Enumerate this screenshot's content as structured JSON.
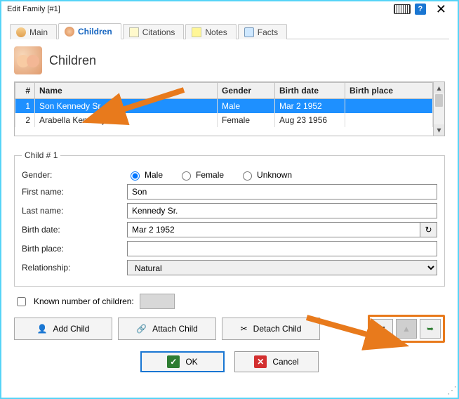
{
  "window": {
    "title": "Edit Family [#1]"
  },
  "tabs": {
    "main": "Main",
    "children": "Children",
    "citations": "Citations",
    "notes": "Notes",
    "facts": "Facts"
  },
  "heading": "Children",
  "grid": {
    "headers": {
      "num": "#",
      "name": "Name",
      "gender": "Gender",
      "birth_date": "Birth date",
      "birth_place": "Birth place"
    },
    "rows": [
      {
        "num": "1",
        "name": "Son Kennedy Sr.",
        "gender": "Male",
        "birth_date": "Mar 2 1952",
        "birth_place": ""
      },
      {
        "num": "2",
        "name": "Arabella Kennedy",
        "gender": "Female",
        "birth_date": "Aug 23 1956",
        "birth_place": ""
      }
    ]
  },
  "detail": {
    "legend": "Child # 1",
    "labels": {
      "gender": "Gender:",
      "first_name": "First name:",
      "last_name": "Last name:",
      "birth_date": "Birth date:",
      "birth_place": "Birth place:",
      "relationship": "Relationship:"
    },
    "gender_options": {
      "male": "Male",
      "female": "Female",
      "unknown": "Unknown"
    },
    "values": {
      "gender": "Male",
      "first_name": "Son",
      "last_name": "Kennedy Sr.",
      "birth_date": "Mar 2 1952",
      "birth_place": "",
      "relationship": "Natural"
    }
  },
  "known": {
    "label": "Known number of children:"
  },
  "actions": {
    "add": "Add Child",
    "attach": "Attach Child",
    "detach": "Detach Child"
  },
  "footer": {
    "ok": "OK",
    "cancel": "Cancel"
  }
}
